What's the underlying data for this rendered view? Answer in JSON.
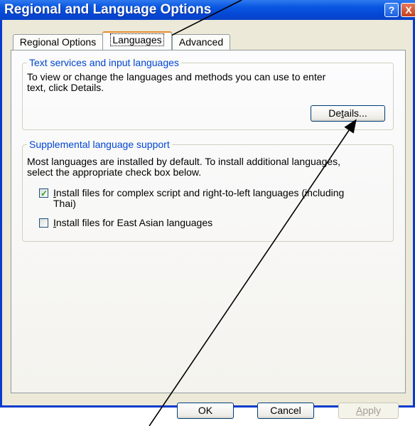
{
  "window": {
    "title": "Regional and Language Options"
  },
  "titlebar": {
    "help_label": "?",
    "close_label": "X"
  },
  "tabs": [
    {
      "label": "Regional Options"
    },
    {
      "label": "Languages"
    },
    {
      "label": "Advanced"
    }
  ],
  "text_services": {
    "legend": "Text services and input languages",
    "desc_line1": "To view or change the languages and methods you can use to enter",
    "desc_line2": "text, click Details.",
    "details_pre": "De",
    "details_ul": "t",
    "details_post": "ails..."
  },
  "supplemental": {
    "legend": "Supplemental language support",
    "desc_line1": "Most languages are installed by default. To install additional languages,",
    "desc_line2": "select the appropriate check box below.",
    "complex_ul": "I",
    "complex_line1": "nstall files for complex script and right-to-left languages (including",
    "complex_line2": "Thai)",
    "complex_checked": true,
    "east_asian_ul": "I",
    "east_asian_label": "nstall files for East Asian languages",
    "east_asian_checked": false
  },
  "footer": {
    "ok_label": "OK",
    "cancel_label": "Cancel",
    "apply_ul": "A",
    "apply_label": "pply"
  }
}
